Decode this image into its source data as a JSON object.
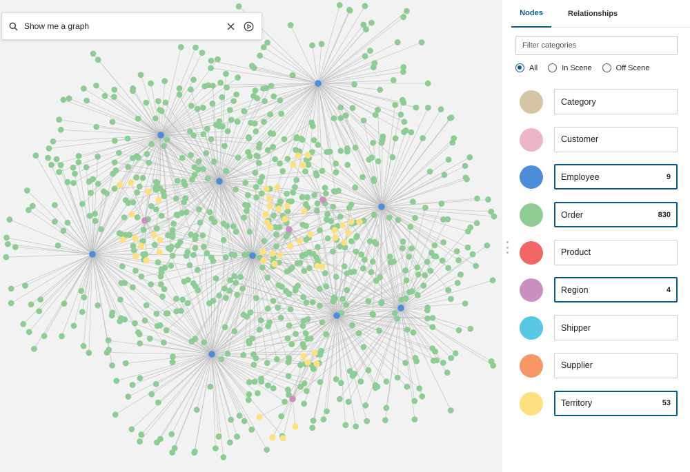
{
  "search": {
    "value": "Show me a graph",
    "placeholder": ""
  },
  "tabs": [
    {
      "label": "Nodes",
      "active": true
    },
    {
      "label": "Relationships",
      "active": false
    }
  ],
  "filter": {
    "placeholder": "Filter categories",
    "value": ""
  },
  "radio": {
    "options": [
      "All",
      "In Scene",
      "Off Scene"
    ],
    "selected": "All"
  },
  "categories": [
    {
      "label": "Category",
      "color": "#d5c4a6",
      "count": "",
      "active": false
    },
    {
      "label": "Customer",
      "color": "#ecb5c9",
      "count": "",
      "active": false
    },
    {
      "label": "Employee",
      "color": "#4c8ed9",
      "count": "9",
      "active": true
    },
    {
      "label": "Order",
      "color": "#8dcc93",
      "count": "830",
      "active": true
    },
    {
      "label": "Product",
      "color": "#f16667",
      "count": "",
      "active": false
    },
    {
      "label": "Region",
      "color": "#c990c0",
      "count": "4",
      "active": true
    },
    {
      "label": "Shipper",
      "color": "#57c7e3",
      "count": "",
      "active": false
    },
    {
      "label": "Supplier",
      "color": "#f79767",
      "count": "",
      "active": false
    },
    {
      "label": "Territory",
      "color": "#ffe081",
      "count": "53",
      "active": true
    }
  ],
  "graph": {
    "colors": {
      "employee": "#4c8ed9",
      "order": "#8dcc93",
      "region": "#c990c0",
      "territory": "#ffe081",
      "edge": "#bdbdbd",
      "background": "#f2f2f2"
    }
  },
  "icons": {
    "search": "search-icon",
    "clear": "close-icon",
    "run": "play-circle-icon",
    "handle": "drag-handle-icon"
  }
}
